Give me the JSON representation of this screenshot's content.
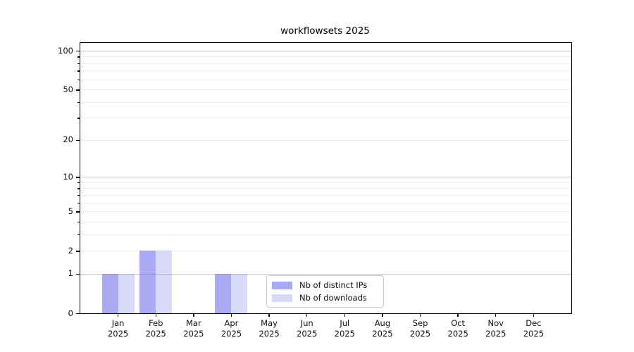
{
  "chart_data": {
    "type": "bar",
    "title": "workflowsets 2025",
    "categories": [
      {
        "month": "Jan",
        "year": "2025"
      },
      {
        "month": "Feb",
        "year": "2025"
      },
      {
        "month": "Mar",
        "year": "2025"
      },
      {
        "month": "Apr",
        "year": "2025"
      },
      {
        "month": "May",
        "year": "2025"
      },
      {
        "month": "Jun",
        "year": "2025"
      },
      {
        "month": "Jul",
        "year": "2025"
      },
      {
        "month": "Aug",
        "year": "2025"
      },
      {
        "month": "Sep",
        "year": "2025"
      },
      {
        "month": "Oct",
        "year": "2025"
      },
      {
        "month": "Nov",
        "year": "2025"
      },
      {
        "month": "Dec",
        "year": "2025"
      }
    ],
    "series": [
      {
        "name": "Nb of distinct IPs",
        "color": "#aaaaf5",
        "values": [
          1,
          2,
          0,
          1,
          0,
          0,
          0,
          0,
          0,
          0,
          0,
          0
        ]
      },
      {
        "name": "Nb of downloads",
        "color": "#d9d9f8",
        "values": [
          1,
          2,
          0,
          1,
          0,
          0,
          0,
          0,
          0,
          0,
          0,
          0
        ]
      }
    ],
    "xlabel": "",
    "ylabel": "",
    "y_scale": "log1p",
    "ylim": [
      0,
      115
    ],
    "y_ticks": [
      0,
      1,
      2,
      5,
      10,
      20,
      50,
      100
    ],
    "y_major_gridlines": [
      1,
      10,
      100
    ],
    "y_minor_gridlines": [
      2,
      3,
      4,
      5,
      6,
      7,
      8,
      9,
      20,
      30,
      40,
      50,
      60,
      70,
      80,
      90
    ],
    "grid": true,
    "legend_position": "lower center"
  }
}
